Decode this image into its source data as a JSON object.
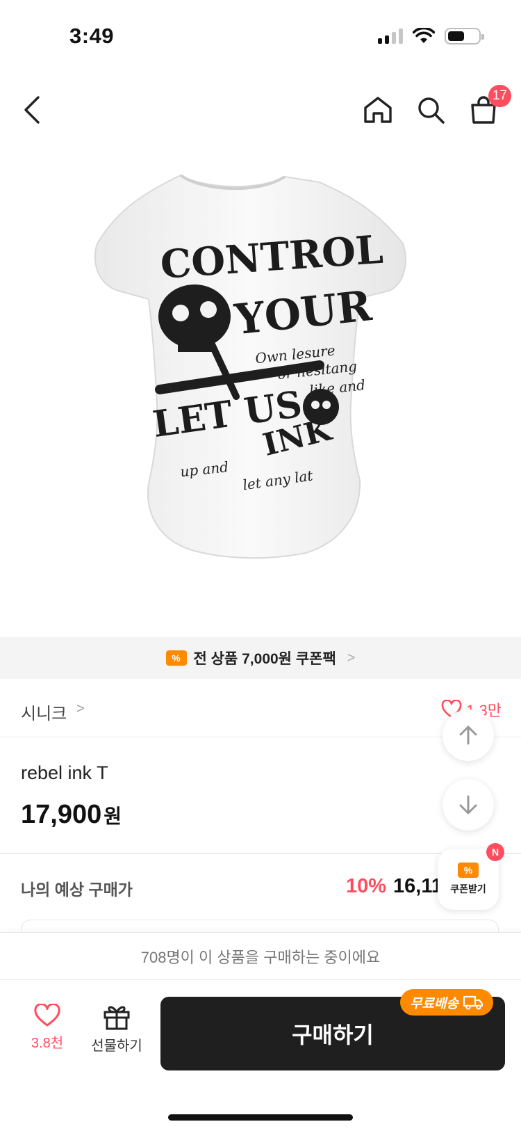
{
  "status_bar": {
    "time": "3:49"
  },
  "nav": {
    "cart_badge": "17"
  },
  "product_image": {
    "shirt_print_lines": [
      "CONTROL",
      "YOUR",
      "LET US",
      "INK"
    ],
    "script_lines": [
      "Own lesure",
      "or hesitang",
      "like and",
      "up and",
      "let any lat"
    ]
  },
  "coupon_banner": {
    "icon": "%",
    "text": "전 상품 7,000원 쿠폰팩",
    "chevron": ">"
  },
  "brand": {
    "name": "시니크",
    "chevron": ">",
    "likes": "1.3만"
  },
  "product": {
    "name": "rebel ink T",
    "price": "17,900",
    "price_unit": "원"
  },
  "expected_price": {
    "label": "나의 예상 구매가",
    "discount": "10%",
    "price": "16,11"
  },
  "coupon_float": {
    "label": "쿠폰받기",
    "badge": "N"
  },
  "bottom": {
    "buyers_text": "708명이 이 상품을 구매하는 중이에요",
    "wish_count": "3.8천",
    "gift_label": "선물하기",
    "buy_label": "구매하기",
    "free_shipping_label": "무료배송"
  },
  "colors": {
    "accent_pink": "#ff4d5f",
    "accent_orange": "#ff8a00",
    "buy_button": "#1f1f1f"
  },
  "icons": [
    "chevron-left-icon",
    "home-icon",
    "search-icon",
    "shopping-bag-icon",
    "coupon-icon",
    "heart-icon",
    "arrow-up-icon",
    "arrow-down-icon",
    "gift-icon",
    "truck-icon"
  ]
}
